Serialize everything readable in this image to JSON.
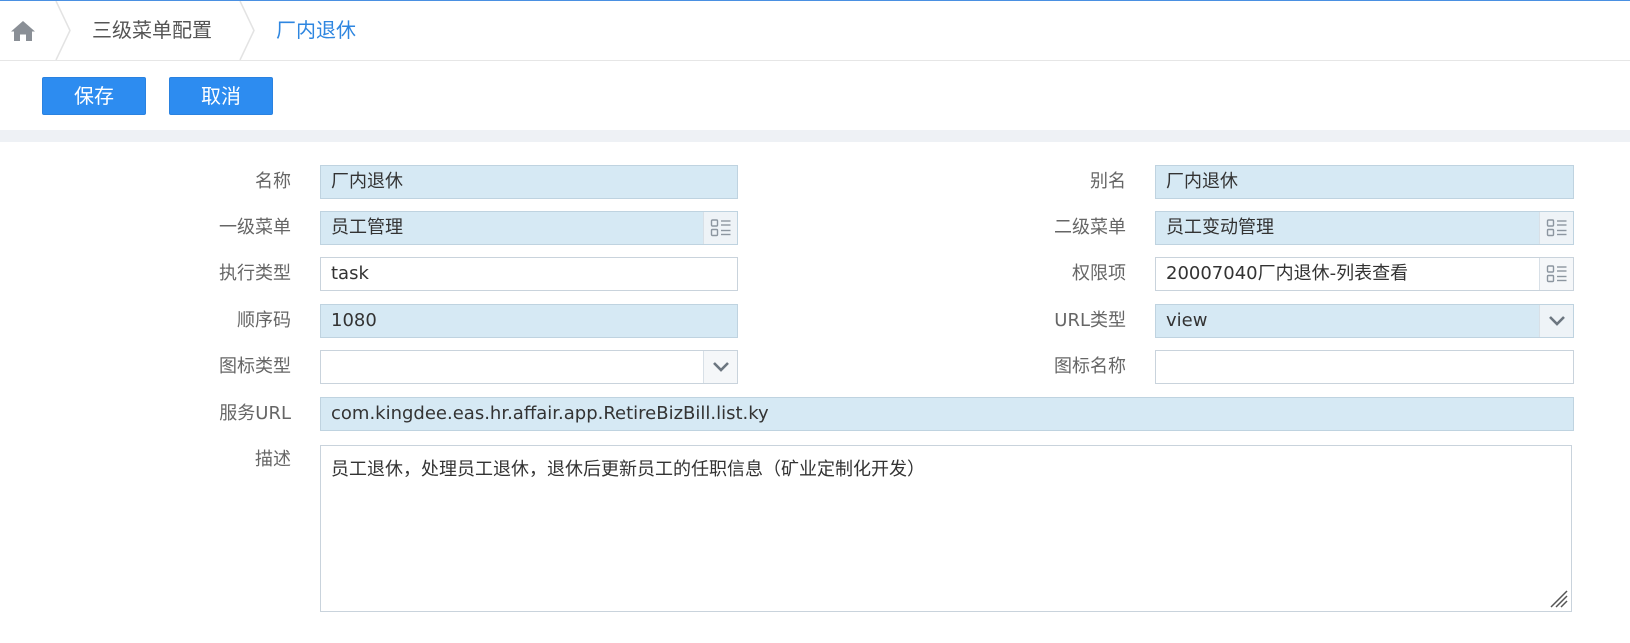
{
  "breadcrumb": {
    "home_icon": "home-icon",
    "parent": "三级菜单配置",
    "current": "厂内退休"
  },
  "toolbar": {
    "save_label": "保存",
    "cancel_label": "取消"
  },
  "form": {
    "name": {
      "label": "名称",
      "value": "厂内退休"
    },
    "alias": {
      "label": "别名",
      "value": "厂内退休"
    },
    "first_menu": {
      "label": "一级菜单",
      "value": "员工管理",
      "icon": "list-picker-icon"
    },
    "second_menu": {
      "label": "二级菜单",
      "value": "员工变动管理",
      "icon": "list-picker-icon"
    },
    "exec_type": {
      "label": "执行类型",
      "value": "task"
    },
    "permission": {
      "label": "权限项",
      "value": "20007040厂内退休-列表查看",
      "icon": "list-picker-icon"
    },
    "order_code": {
      "label": "顺序码",
      "value": "1080"
    },
    "url_type": {
      "label": "URL类型",
      "value": "view",
      "icon": "chevron-down-icon"
    },
    "icon_type": {
      "label": "图标类型",
      "value": "",
      "icon": "chevron-down-icon"
    },
    "icon_name": {
      "label": "图标名称",
      "value": ""
    },
    "service_url": {
      "label": "服务URL",
      "value": "com.kingdee.eas.hr.affair.app.RetireBizBill.list.ky"
    },
    "description": {
      "label": "描述",
      "value": "员工退休，处理员工退休，退休后更新员工的任职信息（矿业定制化开发）"
    }
  },
  "colors": {
    "accent": "#2d8cf0",
    "breadcrumb_current": "#2e86e0",
    "filled_field": "#d6e9f4",
    "label": "#666666"
  }
}
